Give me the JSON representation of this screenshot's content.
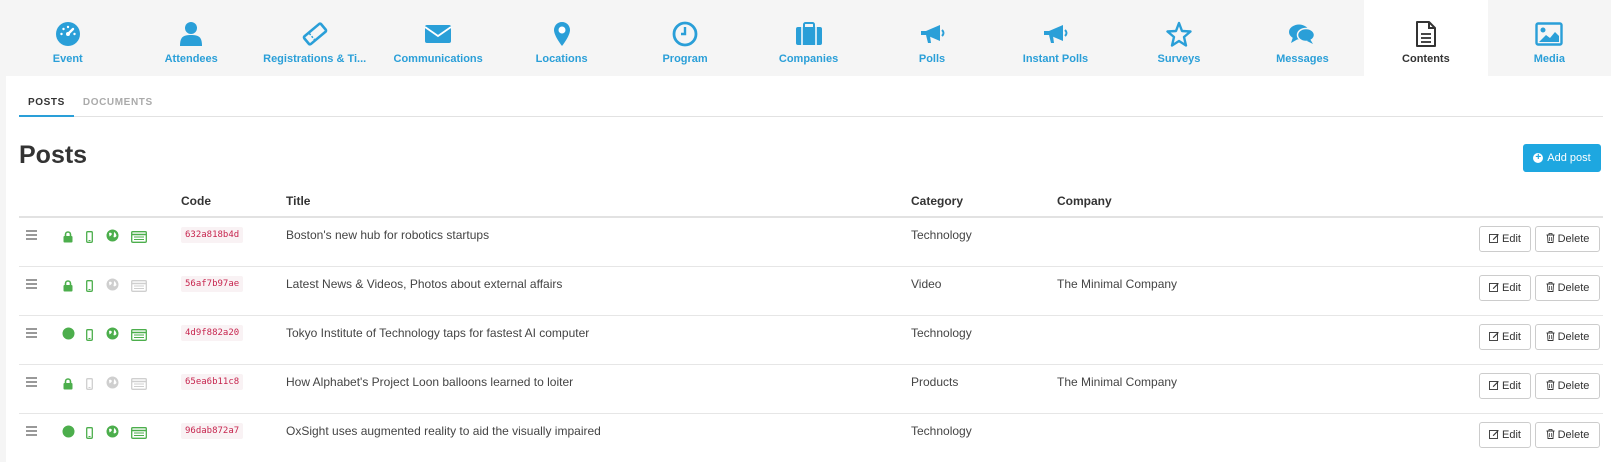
{
  "nav": [
    {
      "label": "Event",
      "icon": "dashboard-icon",
      "active": false
    },
    {
      "label": "Attendees",
      "icon": "user-icon",
      "active": false
    },
    {
      "label": "Registrations & Ti...",
      "icon": "ticket-icon",
      "active": false
    },
    {
      "label": "Communications",
      "icon": "envelope-icon",
      "active": false
    },
    {
      "label": "Locations",
      "icon": "map-marker-icon",
      "active": false
    },
    {
      "label": "Program",
      "icon": "clock-icon",
      "active": false
    },
    {
      "label": "Companies",
      "icon": "briefcase-icon",
      "active": false
    },
    {
      "label": "Polls",
      "icon": "bullhorn-icon",
      "active": false
    },
    {
      "label": "Instant Polls",
      "icon": "bullhorn-icon",
      "active": false
    },
    {
      "label": "Surveys",
      "icon": "star-icon",
      "active": false
    },
    {
      "label": "Messages",
      "icon": "comments-icon",
      "active": false
    },
    {
      "label": "Contents",
      "icon": "document-icon",
      "active": true
    },
    {
      "label": "Media",
      "icon": "image-icon",
      "active": false
    }
  ],
  "subtabs": [
    {
      "label": "POSTS",
      "active": true
    },
    {
      "label": "DOCUMENTS",
      "active": false
    }
  ],
  "page_title": "Posts",
  "add_button": "Add post",
  "columns": {
    "code": "Code",
    "title": "Title",
    "category": "Category",
    "company": "Company"
  },
  "edit_label": "Edit",
  "delete_label": "Delete",
  "rows": [
    {
      "code": "632a818b4d",
      "title": "Boston's new hub for robotics startups",
      "category": "Technology",
      "company": "",
      "status": "locked",
      "mobile": true,
      "web": true,
      "listed": true
    },
    {
      "code": "56af7b97ae",
      "title": "Latest News & Videos, Photos about external affairs",
      "category": "Video",
      "company": "The Minimal Company",
      "status": "locked",
      "mobile": true,
      "web": false,
      "listed": false
    },
    {
      "code": "4d9f882a20",
      "title": "Tokyo Institute of Technology taps for fastest AI computer",
      "category": "Technology",
      "company": "",
      "status": "published",
      "mobile": true,
      "web": true,
      "listed": true
    },
    {
      "code": "65ea6b11c8",
      "title": "How Alphabet's Project Loon balloons learned to loiter",
      "category": "Products",
      "company": "The Minimal Company",
      "status": "locked",
      "mobile": false,
      "web": false,
      "listed": false
    },
    {
      "code": "96dab872a7",
      "title": "OxSight uses augmented reality to aid the visually impaired",
      "category": "Technology",
      "company": "",
      "status": "published",
      "mobile": true,
      "web": true,
      "listed": true
    }
  ],
  "colors": {
    "accent": "#2a9fd8",
    "button": "#1ea7e0",
    "status_green": "#4cae4c",
    "inactive_gray": "#cfcfcf",
    "code_text": "#c7254e"
  }
}
